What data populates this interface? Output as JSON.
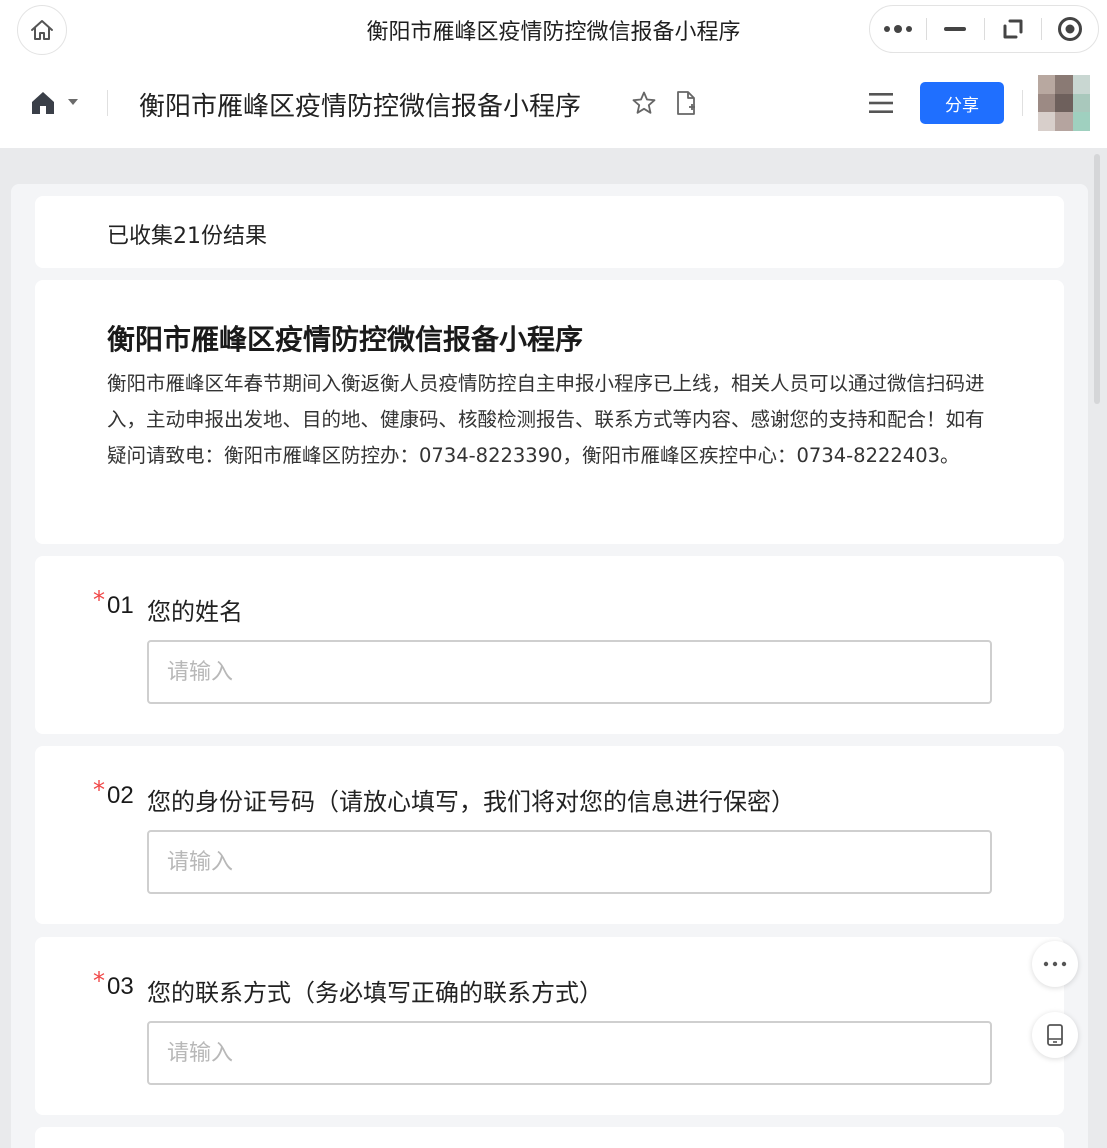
{
  "window": {
    "title": "衡阳市雁峰区疫情防控微信报备小程序"
  },
  "header": {
    "title": "衡阳市雁峰区疫情防控微信报备小程序",
    "share_label": "分享"
  },
  "form": {
    "count_text": "已收集21份结果",
    "title": "衡阳市雁峰区疫情防控微信报备小程序",
    "description": "衡阳市雁峰区年春节期间入衡返衡人员疫情防控自主申报小程序已上线，相关人员可以通过微信扫码进入，主动申报出发地、目的地、健康码、核酸检测报告、联系方式等内容、感谢您的支持和配合！如有疑问请致电：衡阳市雁峰区防控办：0734-8223390，衡阳市雁峰区疾控中心：0734-8222403。",
    "questions": [
      {
        "required_mark": "*",
        "number": "01",
        "label": "您的姓名",
        "placeholder": "请输入",
        "value": ""
      },
      {
        "required_mark": "*",
        "number": "02",
        "label": "您的身份证号码（请放心填写，我们将对您的信息进行保密）",
        "placeholder": "请输入",
        "value": ""
      },
      {
        "required_mark": "*",
        "number": "03",
        "label": "您的联系方式（务必填写正确的联系方式）",
        "placeholder": "请输入",
        "value": ""
      }
    ]
  },
  "colors": {
    "accent": "#1f6fff",
    "required": "#f04646",
    "background": "#e9eaec"
  },
  "icons": [
    "home-icon",
    "more-dots-icon",
    "minimize-icon",
    "restore-icon",
    "record-icon",
    "star-icon",
    "add-document-icon",
    "menu-icon",
    "tablet-icon"
  ]
}
